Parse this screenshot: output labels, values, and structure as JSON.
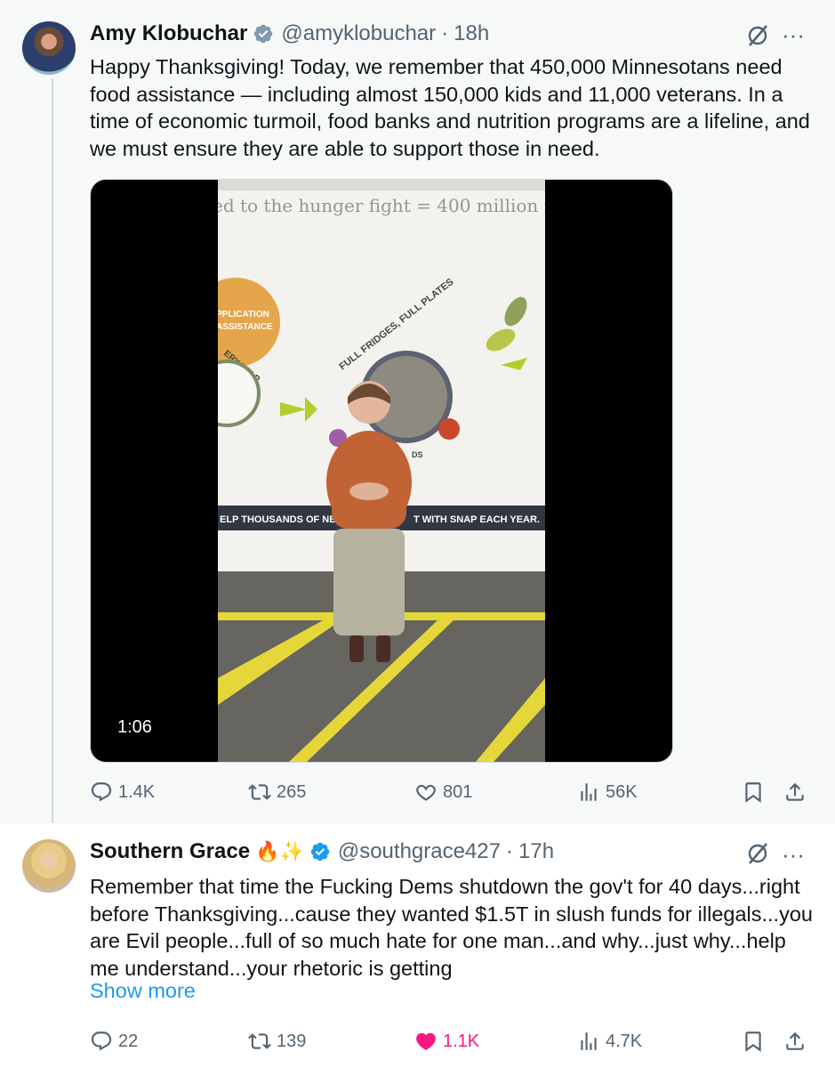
{
  "post1": {
    "name": "Amy Klobuchar",
    "handle": "@amyklobuchar",
    "dot": "·",
    "time": "18h",
    "text": "Happy Thanksgiving! Today, we remember that 450,000 Minnesotans need food assistance — including almost 150,000 kids and 11,000 veterans. In a time of economic turmoil, food banks and nutrition programs are a lifeline, and we must ensure they are able to support those in need.",
    "video": {
      "duration": "1:06",
      "wall_text_top": "ed to the hunger fight = 400 million m",
      "badge_line1": "PPLICATION",
      "badge_line2": "ASSISTANCE",
      "arc_left": "ERY HELP",
      "circle_text": "FULL FRIDGES, FULL PLATES",
      "banner_left": "ELP THOUSANDS OF NE",
      "banner_right": "T WITH SNAP EACH YEAR.",
      "ds": "DS"
    },
    "actions": {
      "replies": "1.4K",
      "reposts": "265",
      "likes": "801",
      "views": "56K"
    }
  },
  "post2": {
    "name": "Southern Grace",
    "emojis": "🔥✨",
    "handle": "@southgrace427",
    "dot": "·",
    "time": "17h",
    "text": "Remember that time the Fucking Dems shutdown the gov't for 40 days...right before Thanksgiving...cause they wanted $1.5T in slush funds for illegals...you are Evil people...full of so much hate for one man...and why...just why...help me understand...your rhetoric is getting",
    "show_more": "Show more",
    "actions": {
      "replies": "22",
      "reposts": "139",
      "likes": "1.1K",
      "views": "4.7K"
    }
  },
  "colors": {
    "accent": "#1d9bf0",
    "like": "#f91880",
    "muted": "#536471"
  },
  "more_glyph": "···"
}
